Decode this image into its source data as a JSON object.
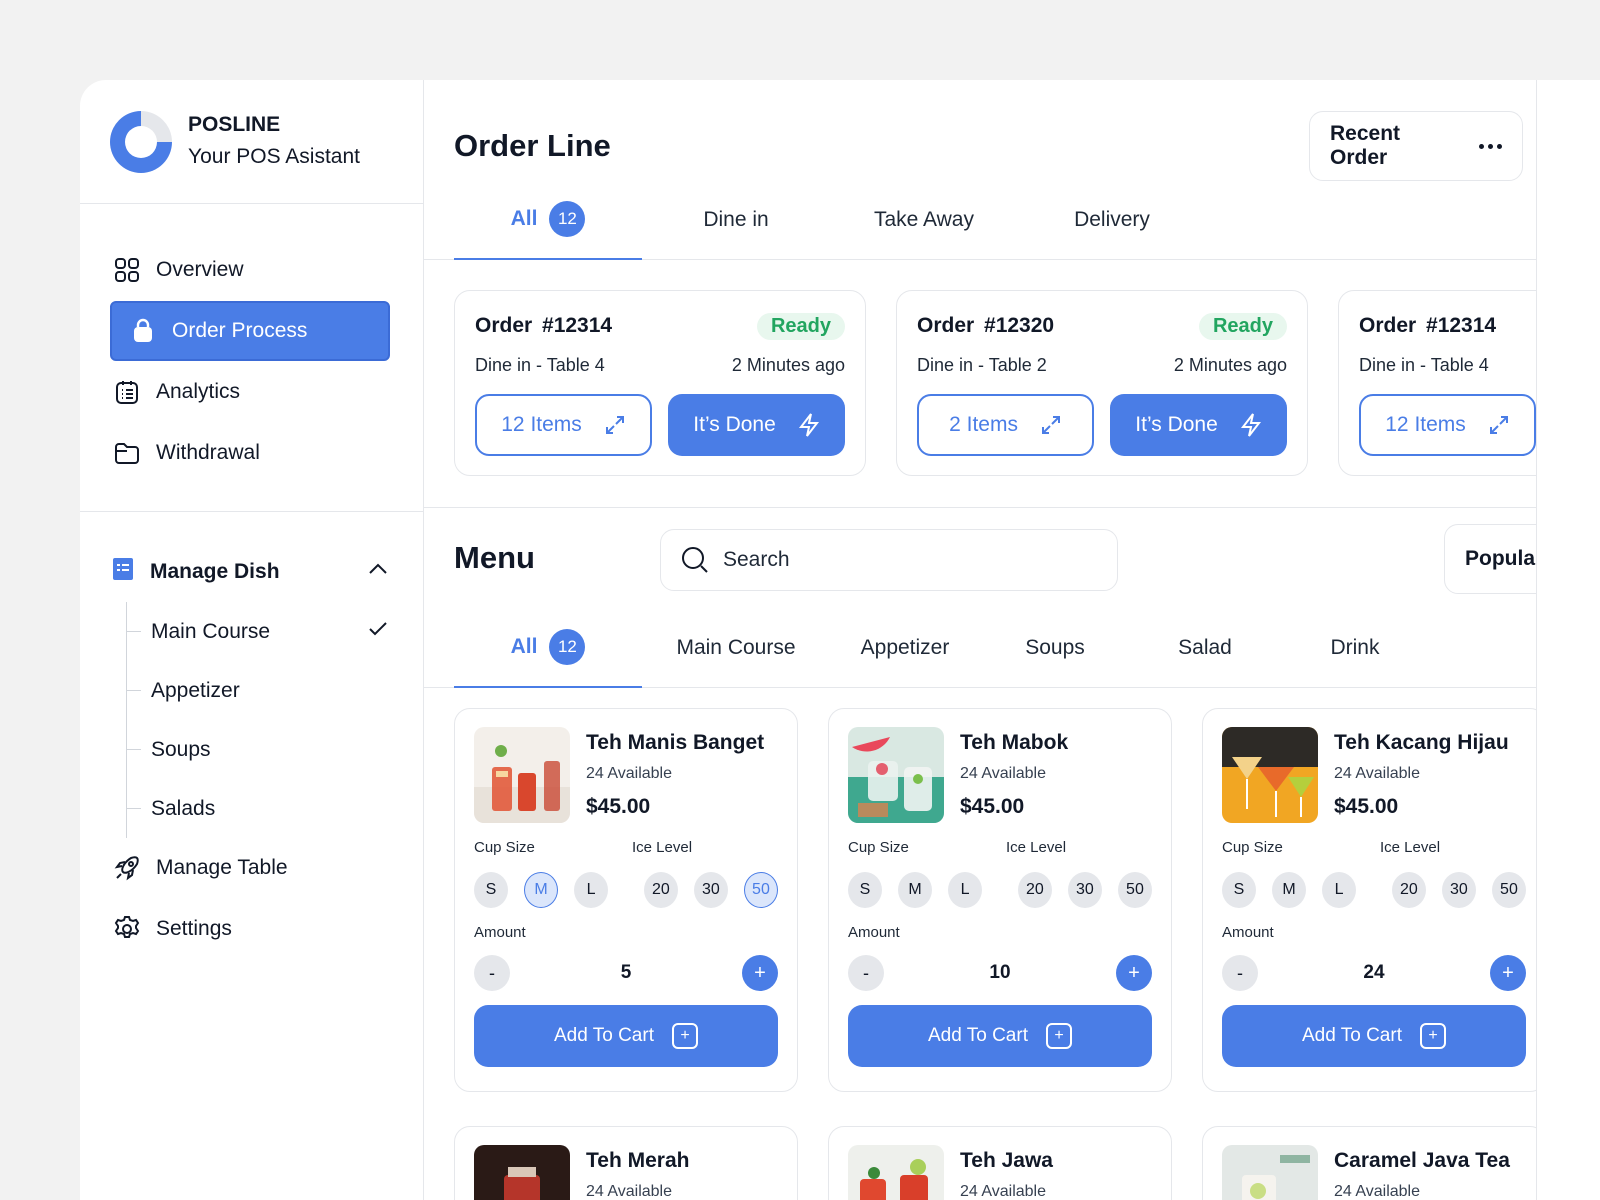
{
  "brand": {
    "name": "POSLINE",
    "tagline": "Your POS Asistant"
  },
  "nav": {
    "items": [
      {
        "label": "Overview",
        "icon": "grid-icon"
      },
      {
        "label": "Order Process",
        "icon": "shopping-bag-icon",
        "active": true
      },
      {
        "label": "Analytics",
        "icon": "clipboard-list-icon"
      },
      {
        "label": "Withdrawal",
        "icon": "folder-icon"
      }
    ]
  },
  "manage_dish": {
    "title": "Manage Dish",
    "items": [
      "Main Course",
      "Appetizer",
      "Soups",
      "Salads"
    ],
    "checked": "Main Course"
  },
  "nav2": {
    "items": [
      {
        "label": "Manage Table",
        "icon": "rocket-icon"
      },
      {
        "label": "Settings",
        "icon": "gear-icon"
      }
    ]
  },
  "order_line": {
    "title": "Order Line",
    "recent_label": "Recent Order",
    "tabs": [
      {
        "label": "All",
        "count": "12",
        "active": true
      },
      {
        "label": "Dine in"
      },
      {
        "label": "Take Away"
      },
      {
        "label": "Delivery"
      }
    ],
    "orders": [
      {
        "title": "Order  #12314",
        "status": "Ready",
        "table": "Dine in - Table 4",
        "time": "2 Minutes ago",
        "items": "12 Items",
        "done": "It’s Done"
      },
      {
        "title": "Order  #12320",
        "status": "Ready",
        "table": "Dine in - Table 2",
        "time": "2 Minutes ago",
        "items": "2 Items",
        "done": "It’s Done"
      },
      {
        "title": "Order  #12314",
        "status": "",
        "table": "Dine in - Table 4",
        "time": "",
        "items": "12 Items",
        "done": ""
      }
    ]
  },
  "menu": {
    "title": "Menu",
    "search_placeholder": "Search",
    "sort_label": "Popular",
    "tabs": [
      {
        "label": "All",
        "count": "12",
        "active": true
      },
      {
        "label": "Main Course"
      },
      {
        "label": "Appetizer"
      },
      {
        "label": "Soups"
      },
      {
        "label": "Salad"
      },
      {
        "label": "Drink"
      }
    ],
    "labels": {
      "cup_size": "Cup Size",
      "ice_level": "Ice Level",
      "amount": "Amount",
      "add_to_cart": "Add To Cart"
    },
    "cup_sizes": [
      "S",
      "M",
      "L"
    ],
    "ice_levels": [
      "20",
      "30",
      "50"
    ],
    "dishes": [
      {
        "name": "Teh Manis Banget",
        "available": "24 Available",
        "price": "$45.00",
        "qty": "5",
        "sel_size": "M",
        "sel_ice": "50"
      },
      {
        "name": "Teh Mabok",
        "available": "24 Available",
        "price": "$45.00",
        "qty": "10"
      },
      {
        "name": "Teh Kacang Hijau",
        "available": "24 Available",
        "price": "$45.00",
        "qty": "24"
      },
      {
        "name": "Teh Merah",
        "available": "24 Available"
      },
      {
        "name": "Teh Jawa",
        "available": "24 Available"
      },
      {
        "name": "Caramel Java Tea",
        "available": "24 Available"
      }
    ]
  },
  "colors": {
    "accent": "#4a7de6",
    "ready_bg": "#e8f7ee",
    "ready_text": "#22a560"
  }
}
